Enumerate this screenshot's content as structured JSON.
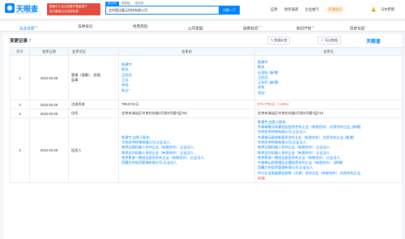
{
  "header": {
    "logo_text": "天眼查",
    "logo_sub": "TianYanCha.com",
    "promo_line1": "国家中小企业发展子基金旗下",
    "promo_line2": "官方备案企业征信机构",
    "search_tabs": [
      "查公司",
      "查老板",
      "查关系"
    ],
    "search_value": "北京图达嘉元科技有限公司",
    "search_button": "天眼一下",
    "nav": [
      "应用",
      "财务速递",
      "企业福气",
      "开通会员"
    ],
    "user": "马尔萨斯"
  },
  "tabs": [
    {
      "label": "企业背景",
      "count": "99+"
    },
    {
      "label": "法律诉讼",
      "count": ""
    },
    {
      "label": "经营风险",
      "count": ""
    },
    {
      "label": "公司发展",
      "count": "1"
    },
    {
      "label": "经营状况",
      "count": "15"
    },
    {
      "label": "知识产权",
      "count": "10"
    },
    {
      "label": "历史信息",
      "count": "1"
    }
  ],
  "section": {
    "title": "变更记录",
    "count": "7",
    "tool1": "数据纠错",
    "tool2": "导出数据",
    "brand": "天眼查"
  },
  "table": {
    "headers": [
      "序号",
      "变更日期",
      "变更项目",
      "变更前",
      "变更后"
    ],
    "rows": [
      {
        "index": "1",
        "date": "2024-03-28",
        "item_lines": [
          "董事（理事）、经理、",
          "监事"
        ],
        "before": [
          "陈建宇,",
          "陈东,",
          "王欣月,",
          "王永,",
          "张培,",
          "陈志*"
        ],
        "after": [
          "陈建宇,",
          "陈东,",
          "石浩阳, [新增]",
          "王欣月,",
          "王永利, [新增]",
          "徐玫,",
          "张志*"
        ]
      },
      {
        "index": "2",
        "date": "2024-03-28",
        "item_lines": [
          "注册资本"
        ],
        "before": [
          "760.6741万"
        ],
        "after": [
          "874.7752万（+15%）"
        ]
      },
      {
        "index": "3",
        "date": "2024-03-28",
        "item_lines": [
          "住所"
        ],
        "before": [
          "北京市海淀区中关村东路1号院3号楼7层701"
        ],
        "after": [
          "北京市海淀区中关村东路1号院3号楼7层710"
        ]
      },
      {
        "index": "4",
        "date": "2024-03-28",
        "item_lines": [
          "投资人"
        ],
        "before": [
          "陈建宇,自然人股东,",
          "华控技术转移有限公司,企业法人,",
          "南京达宸机器人合伙企业（有限合伙）,企业法人,",
          "南京达尔机器人合伙企业（有限合伙）,企业法人,",
          "南京恩源一期创业投资合伙企业（有限合伙）,企业法人,",
          "西藏方舟投资管理有限公司,企业法人,"
        ],
        "after": [
          "陈建宇,自然人股东,",
          "共青城鼎元同誉创业投资合伙企业（有限合伙）,内资合伙企业, [新增]",
          "华控技术转移有限公司,企业法人,",
          "共青城元宸创新投资合伙企业（有限合伙）,内资合伙企业, [新增]",
          "华控技术转移有限公司,企业法人,",
          "南京达宸机器人合伙企业（有限合伙）,企业法人,",
          "南京达尔机器人合伙企业（有限合伙）,企业法人,",
          "南京恩源一期创业投资合伙企业（有限合伙）,企业法人,",
          "宁波梅山保税港区达晟投资合伙企业（有限合伙）, [新增]",
          "西藏方舟投资管理有限公司,企业法人,",
          "中小企业发展基金联智（天津）合伙企业（有限合伙）,内资合伙企业,",
          "[新增]"
        ]
      }
    ]
  }
}
